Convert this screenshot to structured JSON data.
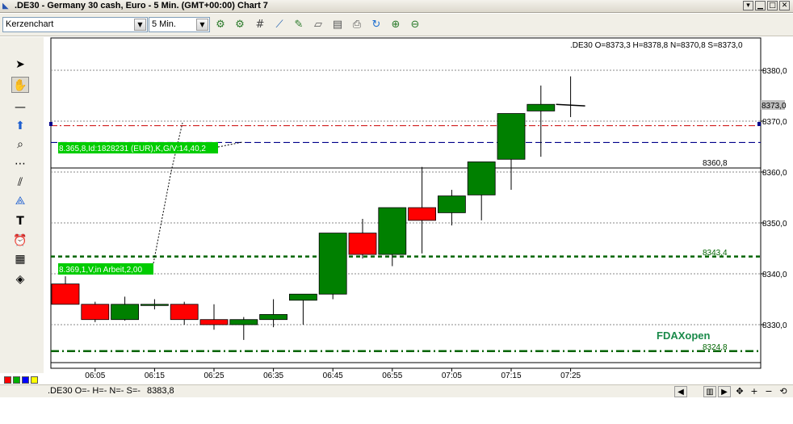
{
  "window": {
    "title": ".DE30 - Germany 30 cash, Euro - 5 Min. (GMT+00:00)   Chart 7"
  },
  "toolbar": {
    "chart_type": "Kerzenchart",
    "interval": "5 Min."
  },
  "chart": {
    "ohlc_header": ".DE30 O=8373,3 H=8378,8 N=8370,8 S=8373,0",
    "current_price_label": "8373,0",
    "hline_8360_label": "8360,8",
    "hline_8343_label": "8343,4",
    "hline_8324_label": "8324,8",
    "fdax_label": "FDAXopen",
    "order_label_1": "8.365,8,Id:1828231 (EUR),K,G/V:14,40,2",
    "order_label_2": "8.369,1,V,in Arbeit,2,00",
    "price_axis_ticks": [
      "8380,0",
      "8370,0",
      "8360,0",
      "8350,0",
      "8340,0",
      "8330,0"
    ],
    "time_axis_ticks": [
      "06:05",
      "06:15",
      "06:25",
      "06:35",
      "06:45",
      "06:55",
      "07:05",
      "07:15",
      "07:25"
    ],
    "colors": {
      "up_candle": "#008000",
      "down_candle": "#ff0000",
      "order_red_line": "#cc0000",
      "order_blue_line": "#00008b",
      "fdax_line": "#006400",
      "label_bg": "#00cc00"
    }
  },
  "chart_data": {
    "type": "candlestick",
    "x": [
      "06:00",
      "06:05",
      "06:10",
      "06:15",
      "06:20",
      "06:25",
      "06:30",
      "06:35",
      "06:40",
      "06:45",
      "06:50",
      "06:55",
      "07:00",
      "07:05",
      "07:10",
      "07:15",
      "07:20",
      "07:25"
    ],
    "open": [
      8338.0,
      8334.0,
      8331.0,
      8334.0,
      8334.0,
      8331.0,
      8330.0,
      8331.0,
      8334.8,
      8336.0,
      8348.0,
      8343.8,
      8353.0,
      8352.0,
      8355.5,
      8362.5,
      8372.0,
      8373.3
    ],
    "high": [
      8339.5,
      8334.5,
      8335.5,
      8335.0,
      8334.5,
      8334.0,
      8331.5,
      8335.0,
      8336.0,
      8340.5,
      8350.8,
      8348.0,
      8361.0,
      8356.5,
      8357.0,
      8366.0,
      8377.0,
      8378.8
    ],
    "low": [
      8334.0,
      8330.5,
      8330.8,
      8333.0,
      8330.0,
      8329.0,
      8327.0,
      8329.5,
      8330.0,
      8335.0,
      8343.0,
      8341.5,
      8344.0,
      8349.5,
      8350.5,
      8356.5,
      8363.0,
      8370.8
    ],
    "close": [
      8334.0,
      8331.0,
      8334.0,
      8334.0,
      8331.0,
      8330.0,
      8331.0,
      8332.0,
      8336.0,
      8348.0,
      8343.8,
      8353.0,
      8350.5,
      8355.3,
      8362.0,
      8371.5,
      8373.3,
      8373.0
    ],
    "ylim": [
      8322.0,
      8385.0
    ],
    "horizontal_lines": [
      {
        "value": 8369.1,
        "label": "",
        "style": "dash-dot",
        "color": "#cc0000"
      },
      {
        "value": 8365.8,
        "label": "",
        "style": "dashed",
        "color": "#00008b"
      },
      {
        "value": 8360.8,
        "label": "8360,8",
        "style": "solid",
        "color": "#000000"
      },
      {
        "value": 8343.4,
        "label": "8343,4",
        "style": "dashed",
        "color": "#006400"
      },
      {
        "value": 8324.8,
        "label": "8324,8",
        "style": "dash-dot",
        "color": "#006400"
      }
    ],
    "grid": true
  },
  "status": {
    "text": ".DE30 O=- H=- N=- S=-",
    "price": "8383,8"
  }
}
